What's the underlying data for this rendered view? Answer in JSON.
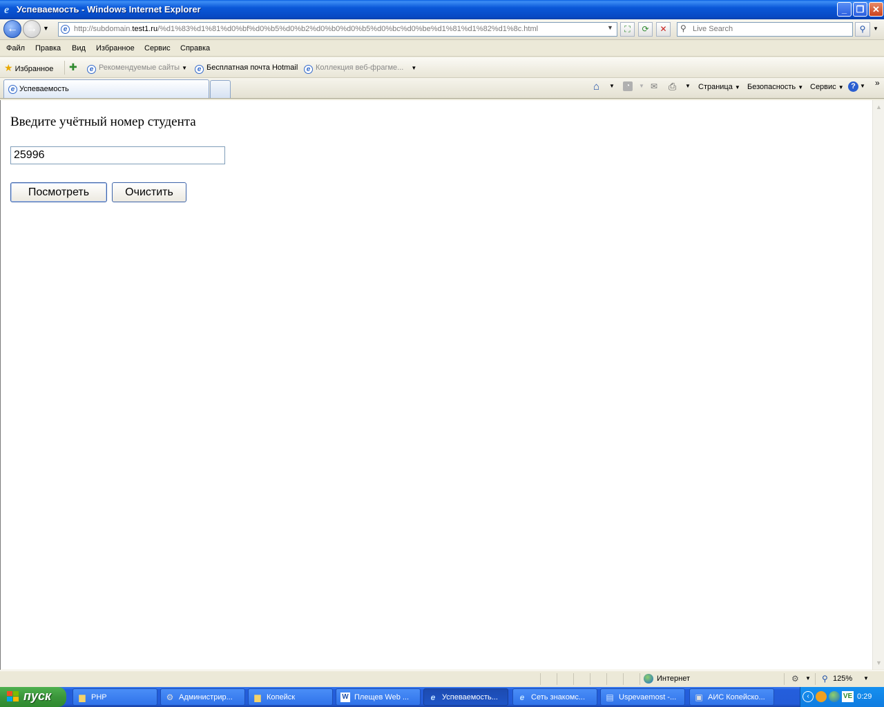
{
  "window": {
    "title": "Успеваемость - Windows Internet Explorer"
  },
  "address_bar": {
    "url_prefix": "http://subdomain.",
    "url_host": "test1.ru",
    "url_path": "/%d1%83%d1%81%d0%bf%d0%b5%d0%b2%d0%b0%d0%b5%d0%bc%d0%be%d1%81%d1%82%d1%8c.html",
    "search_placeholder": "Live Search"
  },
  "menu": [
    "Файл",
    "Правка",
    "Вид",
    "Избранное",
    "Сервис",
    "Справка"
  ],
  "favorites_bar": {
    "favorites_label": "Избранное",
    "items": [
      "Рекомендуемые сайты",
      "Бесплатная почта Hotmail",
      "Коллекция веб-фрагме..."
    ]
  },
  "tabs": {
    "active_label": "Успеваемость"
  },
  "command_bar": {
    "page": "Страница",
    "safety": "Безопасность",
    "tools": "Сервис"
  },
  "page": {
    "prompt": "Введите учётный номер студента",
    "student_id_value": "25996",
    "view_button": "Посмотреть",
    "clear_button": "Очистить"
  },
  "status_bar": {
    "zone": "Интернет",
    "zoom": "125%"
  },
  "taskbar": {
    "start_label": "пуск",
    "tasks": [
      "PHP",
      "Администрир...",
      "Копейск",
      "Плещев Web ...",
      "Успеваемость...",
      "Сеть знакомс...",
      "Uspevaemost -...",
      "АИС Копейско..."
    ],
    "clock": "0:29"
  },
  "colors": {
    "title_bar": "#0a58d8",
    "taskbar": "#245edc",
    "start_button": "#3b963b",
    "chrome": "#ece9d8"
  }
}
